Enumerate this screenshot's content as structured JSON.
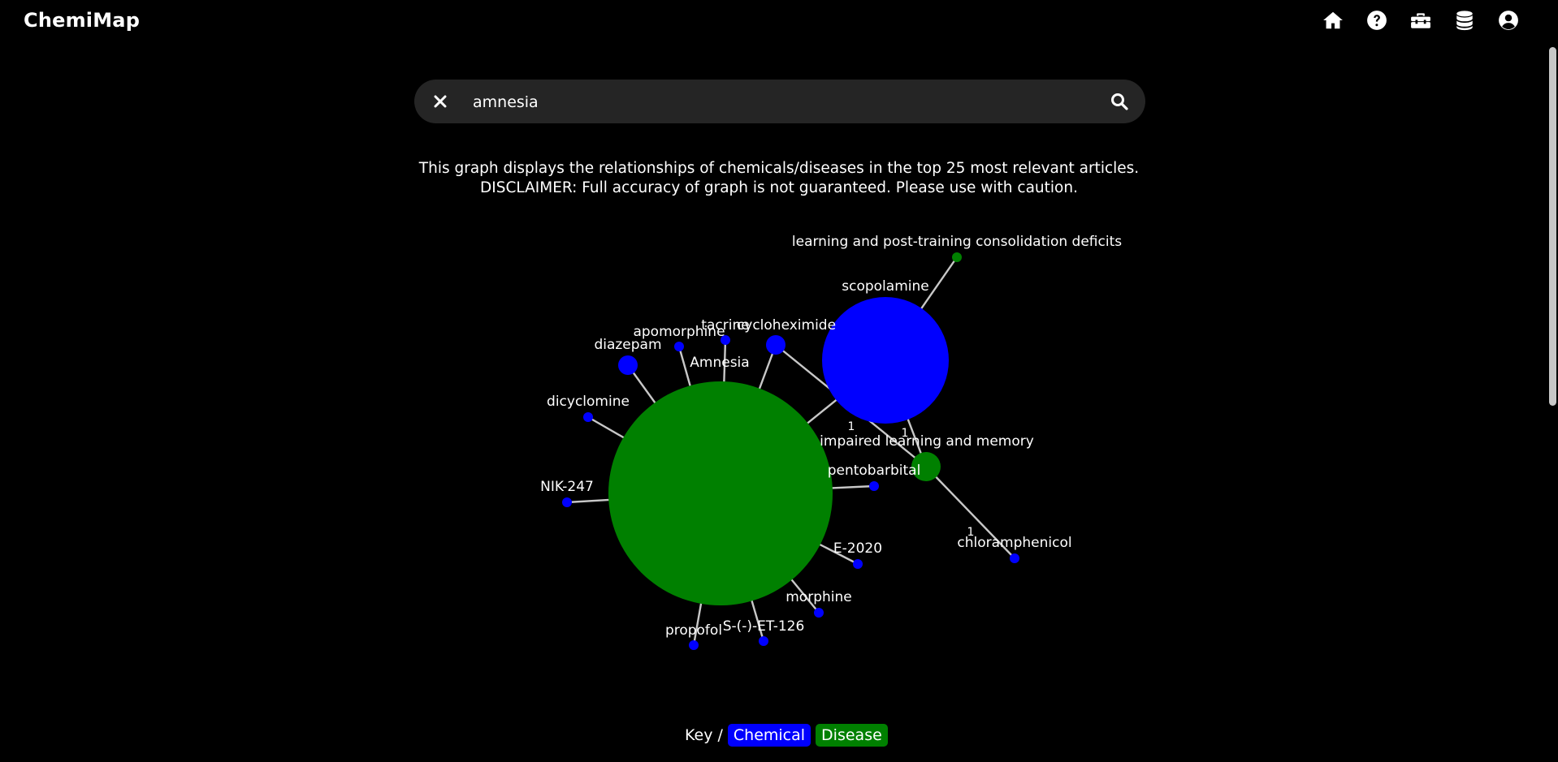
{
  "app": {
    "title": "ChemiMap"
  },
  "nav": {
    "icons": [
      "home-icon",
      "help-icon",
      "toolbox-icon",
      "database-icon",
      "account-icon"
    ]
  },
  "search": {
    "value": "amnesia",
    "placeholder": ""
  },
  "info": {
    "line1": "This graph displays the relationships of chemicals/diseases in the top 25 most relevant articles.",
    "line2": "DISCLAIMER: Full accuracy of graph is not guaranteed. Please use with caution."
  },
  "graph": {
    "colors": {
      "chemical": "#0000ff",
      "disease": "#008000",
      "edge": "#c8c8c8"
    },
    "nodes": [
      {
        "id": "Amnesia",
        "label": "Amnesia",
        "type": "disease"
      },
      {
        "id": "scopolamine",
        "label": "scopolamine",
        "type": "chemical"
      },
      {
        "id": "impaired learning and memory",
        "label": "impaired learning and memory",
        "type": "disease"
      },
      {
        "id": "learning and post-training consolidation deficits",
        "label": "learning and post-training consolidation deficits",
        "type": "disease"
      },
      {
        "id": "cycloheximide",
        "label": "cycloheximide",
        "type": "chemical"
      },
      {
        "id": "tacrine",
        "label": "tacrine",
        "type": "chemical"
      },
      {
        "id": "apomorphine",
        "label": "apomorphine",
        "type": "chemical"
      },
      {
        "id": "diazepam",
        "label": "diazepam",
        "type": "chemical"
      },
      {
        "id": "dicyclomine",
        "label": "dicyclomine",
        "type": "chemical"
      },
      {
        "id": "NIK-247",
        "label": "NIK-247",
        "type": "chemical"
      },
      {
        "id": "pentobarbital",
        "label": "pentobarbital",
        "type": "chemical"
      },
      {
        "id": "E-2020",
        "label": "E-2020",
        "type": "chemical"
      },
      {
        "id": "morphine",
        "label": "morphine",
        "type": "chemical"
      },
      {
        "id": "S-(-)-ET-126",
        "label": "S-(-)-ET-126",
        "type": "chemical"
      },
      {
        "id": "propofol",
        "label": "propofol",
        "type": "chemical"
      },
      {
        "id": "chloramphenicol",
        "label": "chloramphenicol",
        "type": "chemical"
      }
    ],
    "edges": [
      {
        "source": "scopolamine",
        "target": "Amnesia",
        "label": ""
      },
      {
        "source": "scopolamine",
        "target": "learning and post-training consolidation deficits",
        "label": ""
      },
      {
        "source": "scopolamine",
        "target": "impaired learning and memory",
        "label": "1"
      },
      {
        "source": "cycloheximide",
        "target": "impaired learning and memory",
        "label": "1"
      },
      {
        "source": "chloramphenicol",
        "target": "impaired learning and memory",
        "label": "1"
      },
      {
        "source": "cycloheximide",
        "target": "Amnesia",
        "label": ""
      },
      {
        "source": "tacrine",
        "target": "Amnesia",
        "label": ""
      },
      {
        "source": "apomorphine",
        "target": "Amnesia",
        "label": ""
      },
      {
        "source": "diazepam",
        "target": "Amnesia",
        "label": ""
      },
      {
        "source": "dicyclomine",
        "target": "Amnesia",
        "label": ""
      },
      {
        "source": "NIK-247",
        "target": "Amnesia",
        "label": ""
      },
      {
        "source": "pentobarbital",
        "target": "Amnesia",
        "label": ""
      },
      {
        "source": "E-2020",
        "target": "Amnesia",
        "label": ""
      },
      {
        "source": "morphine",
        "target": "Amnesia",
        "label": ""
      },
      {
        "source": "S-(-)-ET-126",
        "target": "Amnesia",
        "label": ""
      },
      {
        "source": "propofol",
        "target": "Amnesia",
        "label": ""
      }
    ]
  },
  "key": {
    "label": "Key /",
    "chemical": "Chemical",
    "disease": "Disease"
  }
}
